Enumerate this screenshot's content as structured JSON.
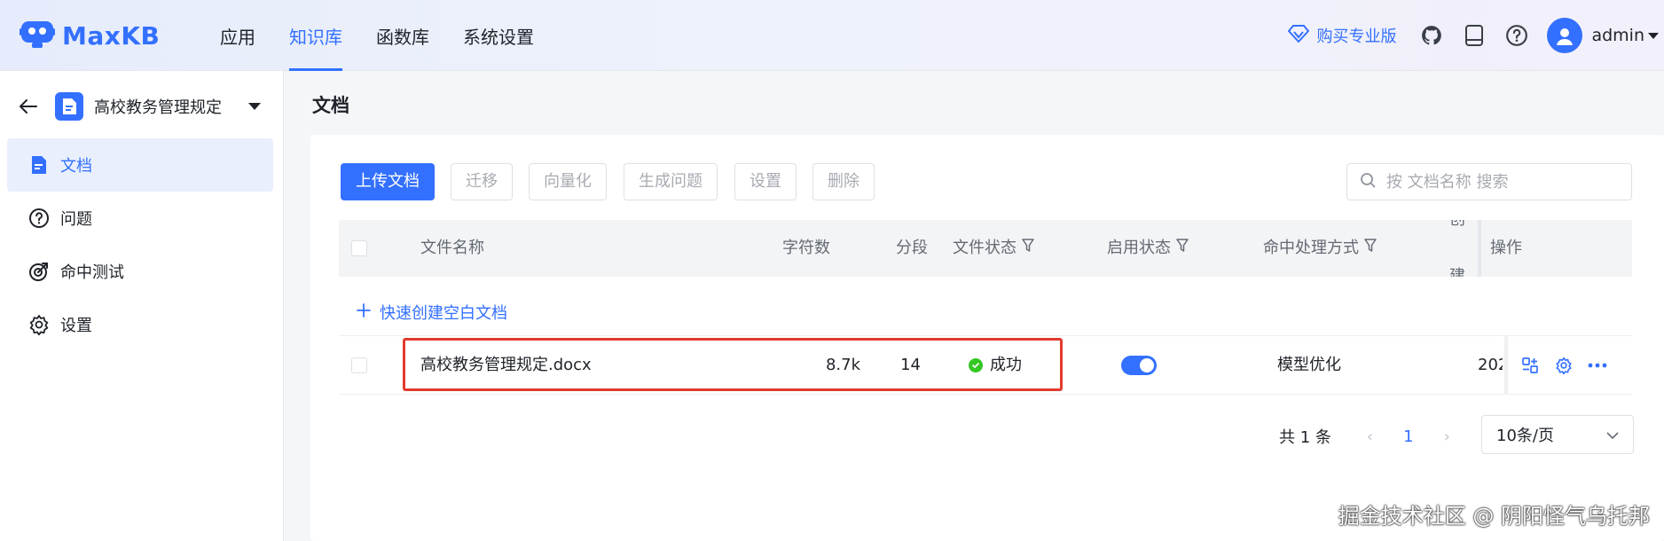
{
  "header": {
    "brand": "MaxKB",
    "nav": [
      {
        "label": "应用",
        "active": false
      },
      {
        "label": "知识库",
        "active": true
      },
      {
        "label": "函数库",
        "active": false
      },
      {
        "label": "系统设置",
        "active": false
      }
    ],
    "buy_pro": "购买专业版",
    "icons": [
      "github-icon",
      "manual-icon",
      "help-icon"
    ],
    "user": "admin"
  },
  "sidebar": {
    "kb_name": "高校教务管理规定",
    "items": [
      {
        "label": "文档",
        "icon": "document-icon",
        "active": true
      },
      {
        "label": "问题",
        "icon": "question-icon",
        "active": false
      },
      {
        "label": "命中测试",
        "icon": "target-icon",
        "active": false
      },
      {
        "label": "设置",
        "icon": "gear-icon",
        "active": false
      }
    ]
  },
  "main": {
    "title": "文档",
    "toolbar": {
      "upload": "上传文档",
      "migrate": "迁移",
      "vectorize": "向量化",
      "gen_questions": "生成问题",
      "settings": "设置",
      "delete": "删除"
    },
    "search_placeholder": "按 文档名称 搜索",
    "columns": {
      "name": "文件名称",
      "chars": "字符数",
      "paragraphs": "分段",
      "file_status": "文件状态",
      "enable_status": "启用状态",
      "hit_mode": "命中处理方式",
      "created": "创建",
      "actions": "操作"
    },
    "quick_create": "快速创建空白文档",
    "rows": [
      {
        "name": "高校教务管理规定.docx",
        "chars": "8.7k",
        "paragraphs": "14",
        "file_status": "成功",
        "enabled": true,
        "hit_mode": "模型优化",
        "created": "202"
      }
    ],
    "pagination": {
      "total": "共 1 条",
      "current": "1",
      "page_size": "10条/页"
    }
  },
  "watermark": "掘金技术社区 @ 阴阳怪气乌托邦",
  "colors": {
    "accent": "#3370ff",
    "success": "#34c724",
    "highlight": "#e33b2e"
  }
}
